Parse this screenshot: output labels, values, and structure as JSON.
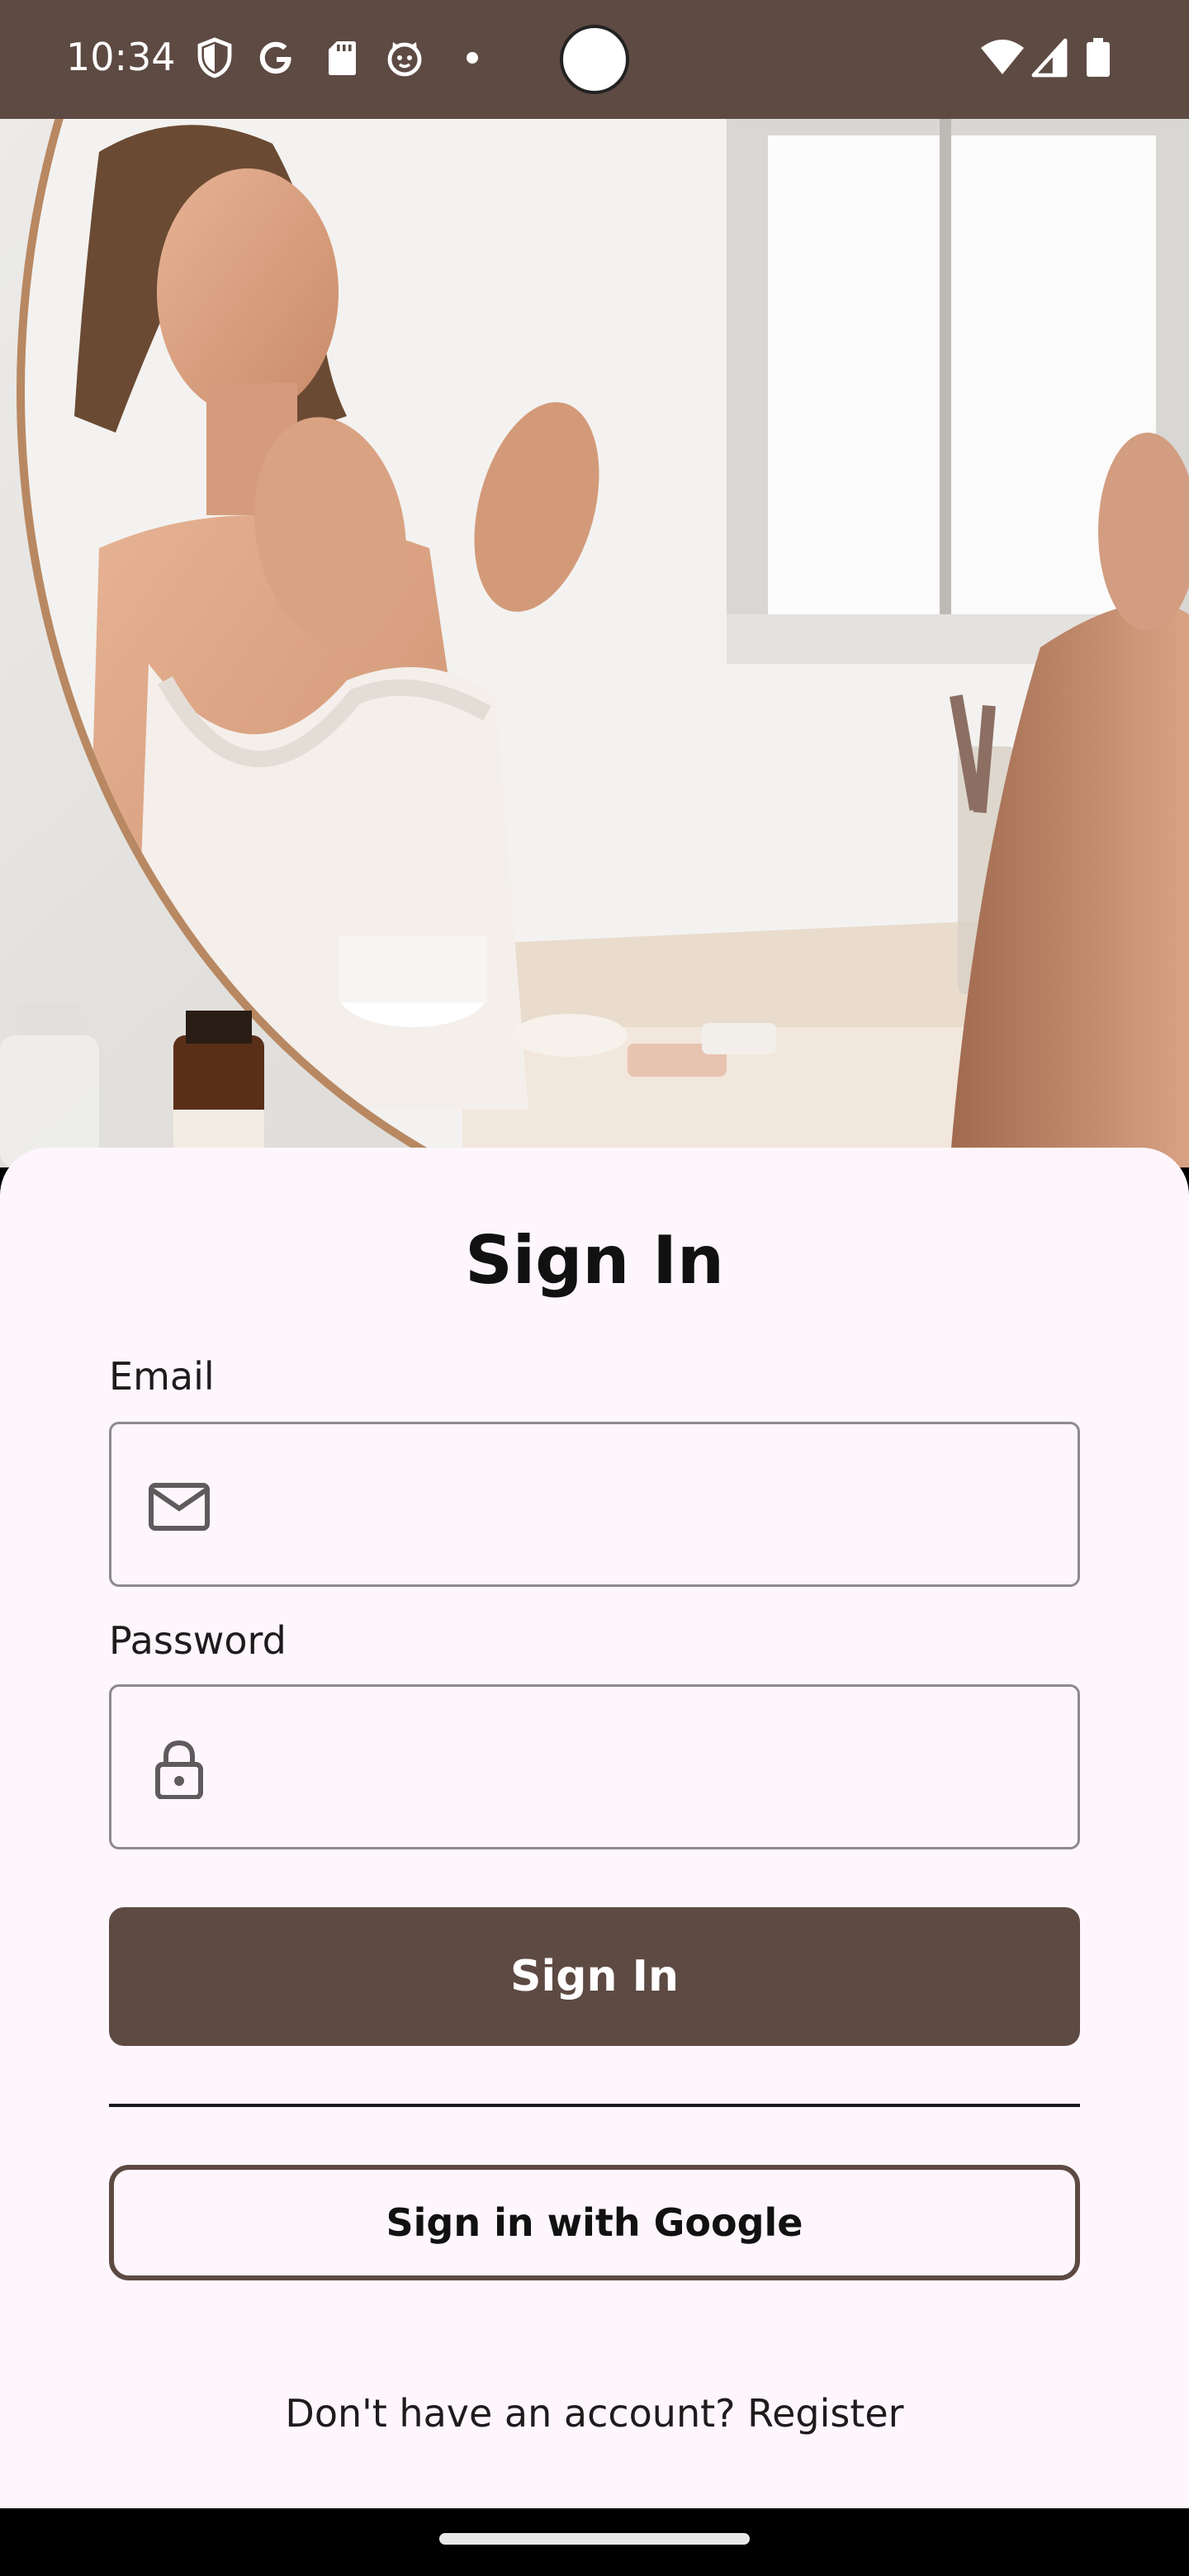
{
  "status_bar": {
    "time": "10:34",
    "icons": [
      "shield-icon",
      "google-icon",
      "sd-card-icon",
      "cat-face-icon",
      "dot-icon",
      "wifi-icon",
      "cell-signal-icon",
      "battery-icon"
    ]
  },
  "hero": {
    "image": "woman-applying-face-cream-at-mirror"
  },
  "signin": {
    "title": "Sign In",
    "email_label": "Email",
    "email_value": "",
    "password_label": "Password",
    "password_value": "",
    "submit_label": "Sign In",
    "google_label": "Sign in with Google",
    "register_text": "Don't have an account? Register"
  },
  "colors": {
    "primary": "#5D4A43",
    "sheet_background": "#FDF6FC",
    "input_border": "#8D8A8C"
  }
}
